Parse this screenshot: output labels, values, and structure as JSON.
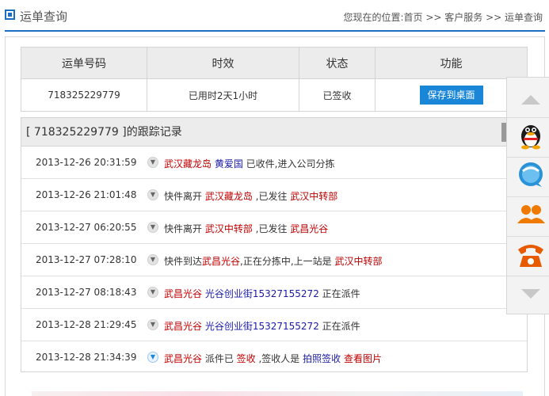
{
  "header": {
    "title": "运单查询",
    "breadcrumb": "您现在的位置:首页 >> 客户服务 >> 运单查询"
  },
  "summary": {
    "columns": [
      "运单号码",
      "时效",
      "状态",
      "功能"
    ],
    "waybill_no": "718325229779",
    "duration": "已用时2天1小时",
    "status": "已签收",
    "action_label": "保存到桌面"
  },
  "tracking": {
    "title": "[ 718325229779 ]的跟踪记录",
    "records": [
      {
        "time": "2013-12-26 20:31:59",
        "parts": [
          {
            "text": "武汉藏龙岛",
            "style": "red"
          },
          {
            "text": " ",
            "style": ""
          },
          {
            "text": "黄爱国",
            "style": "blue"
          },
          {
            "text": " 已收件,进入公司分拣",
            "style": ""
          }
        ]
      },
      {
        "time": "2013-12-26 21:01:48",
        "parts": [
          {
            "text": "快件离开 ",
            "style": ""
          },
          {
            "text": "武汉藏龙岛",
            "style": "red"
          },
          {
            "text": " ,已发往 ",
            "style": ""
          },
          {
            "text": "武汉中转部",
            "style": "red"
          }
        ]
      },
      {
        "time": "2013-12-27 06:20:55",
        "parts": [
          {
            "text": "快件离开 ",
            "style": ""
          },
          {
            "text": "武汉中转部",
            "style": "red"
          },
          {
            "text": " ,已发往 ",
            "style": ""
          },
          {
            "text": "武昌光谷",
            "style": "red"
          }
        ]
      },
      {
        "time": "2013-12-27 07:28:10",
        "parts": [
          {
            "text": "快件到达",
            "style": ""
          },
          {
            "text": "武昌光谷",
            "style": "red"
          },
          {
            "text": ",正在分拣中,上一站是 ",
            "style": ""
          },
          {
            "text": "武汉中转部",
            "style": "red"
          }
        ]
      },
      {
        "time": "2013-12-27 08:18:43",
        "parts": [
          {
            "text": "武昌光谷",
            "style": "red"
          },
          {
            "text": " ",
            "style": ""
          },
          {
            "text": "光谷创业街15327155272",
            "style": "blue"
          },
          {
            "text": " 正在派件",
            "style": ""
          }
        ]
      },
      {
        "time": "2013-12-28 21:29:45",
        "parts": [
          {
            "text": "武昌光谷",
            "style": "red"
          },
          {
            "text": " ",
            "style": ""
          },
          {
            "text": "光谷创业街15327155272",
            "style": "blue"
          },
          {
            "text": " 正在派件",
            "style": ""
          }
        ]
      },
      {
        "time": "2013-12-28 21:34:39",
        "parts": [
          {
            "text": "武昌光谷",
            "style": "red"
          },
          {
            "text": " 派件已 ",
            "style": ""
          },
          {
            "text": "签收",
            "style": "red"
          },
          {
            "text": " ,签收人是 ",
            "style": ""
          },
          {
            "text": "拍照签收",
            "style": "blue"
          },
          {
            "text": " ",
            "style": ""
          },
          {
            "text": "查看图片",
            "style": "red"
          }
        ]
      }
    ]
  },
  "side_panel": {
    "icons": [
      "arrow-up-icon",
      "qq-icon",
      "chat-bubble-icon",
      "users-icon",
      "phone-icon",
      "arrow-down-icon"
    ]
  },
  "colors": {
    "accent": "#1a6fc4",
    "button": "#1a86d8",
    "highlight_red": "#c00000",
    "highlight_blue": "#1a1aa6"
  }
}
